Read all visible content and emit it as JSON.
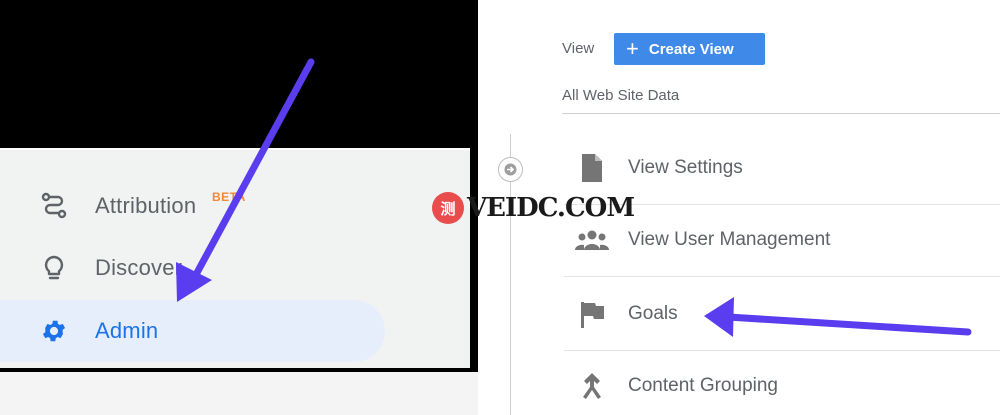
{
  "left_nav": {
    "items": [
      {
        "label": "Attribution",
        "badge": "BETA"
      },
      {
        "label": "Discover"
      },
      {
        "label": "Admin"
      }
    ]
  },
  "right_panel": {
    "view_label": "View",
    "create_view_button": "Create View",
    "site_data": "All Web Site Data",
    "settings": [
      {
        "label": "View Settings",
        "icon": "document-icon"
      },
      {
        "label": "View User Management",
        "icon": "users-icon"
      },
      {
        "label": "Goals",
        "icon": "flag-icon"
      },
      {
        "label": "Content Grouping",
        "icon": "content-grouping-icon"
      }
    ]
  },
  "watermark": {
    "glyph": "测",
    "text": "VEIDC.COM"
  },
  "colors": {
    "accent_blue": "#1a73e8",
    "button_blue": "#3f8ae9",
    "annotation_arrow": "#5b3df0",
    "beta_orange": "#f2873a",
    "watermark_red": "#e84c4c"
  }
}
